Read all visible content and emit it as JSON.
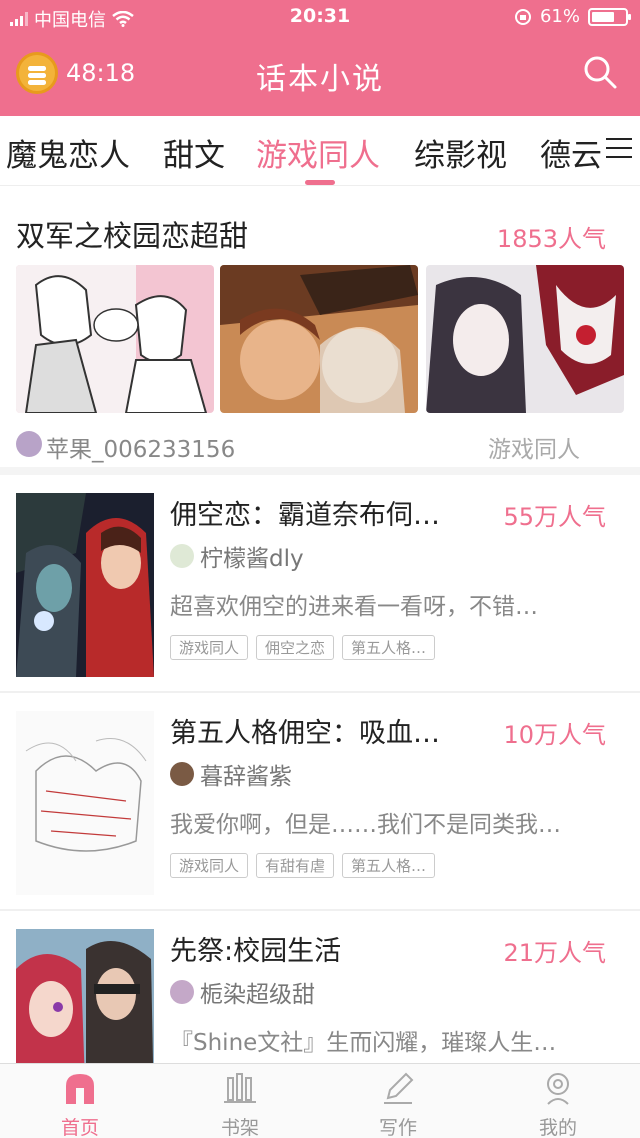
{
  "status_bar": {
    "carrier": "中国电信",
    "time": "20:31",
    "battery": "61%"
  },
  "header": {
    "timer": "48:18",
    "title": "话本小说"
  },
  "tabs": [
    {
      "label": "魔鬼恋人"
    },
    {
      "label": "甜文"
    },
    {
      "label": "游戏同人"
    },
    {
      "label": "综影视"
    },
    {
      "label": "德云"
    }
  ],
  "featured": {
    "title": "双军之校园恋超甜",
    "popularity": "1853人气",
    "author": "苹果_006233156",
    "category": "游戏同人"
  },
  "books": [
    {
      "title": "佣空恋：霸道奈布伺…",
      "popularity": "55万人气",
      "author": "柠檬酱dly",
      "desc": "超喜欢佣空的进来看一看呀，不错…",
      "tags": [
        "游戏同人",
        "佣空之恋",
        "第五人格…"
      ]
    },
    {
      "title": "第五人格佣空：吸血…",
      "popularity": "10万人气",
      "author": "暮辞酱紫",
      "desc": "我爱你啊，但是……我们不是同类我…",
      "tags": [
        "游戏同人",
        "有甜有虐",
        "第五人格…"
      ]
    },
    {
      "title": "先祭:校园生活",
      "popularity": "21万人气",
      "author": "栀染超级甜",
      "desc": "『Shine文社』生而闪耀，璀璨人生…",
      "tags": []
    }
  ],
  "bottom_nav": [
    {
      "label": "首页",
      "icon": "home-icon"
    },
    {
      "label": "书架",
      "icon": "bookshelf-icon"
    },
    {
      "label": "写作",
      "icon": "pen-icon"
    },
    {
      "label": "我的",
      "icon": "profile-icon"
    }
  ],
  "colors": {
    "accent": "#ef6f8e",
    "header_bg": "#ef6f8e"
  }
}
